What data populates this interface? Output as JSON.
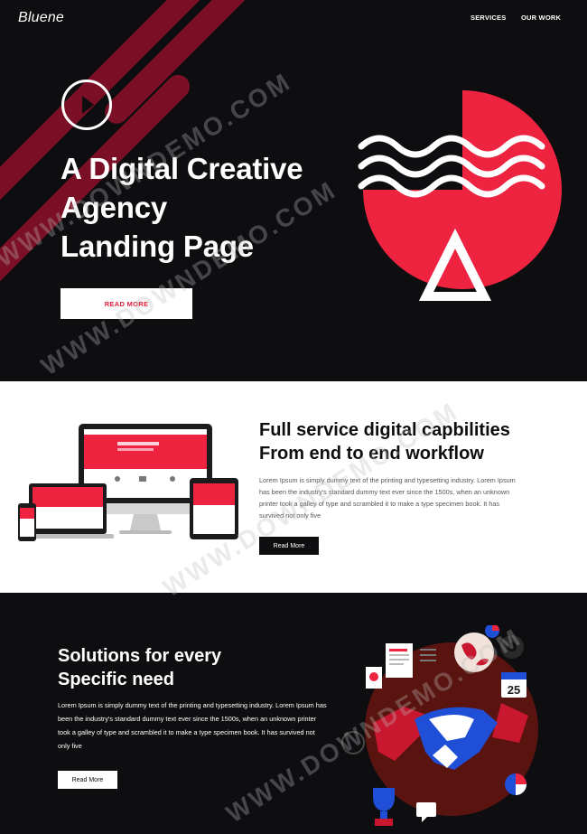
{
  "header": {
    "logo": "Bluene",
    "nav": [
      "SERVICES",
      "OUR WORK"
    ]
  },
  "hero": {
    "title_lines": [
      "A Digital Creative",
      "Agency",
      "Landing Page"
    ],
    "button": "READ MORE"
  },
  "services": {
    "title_lines": [
      "Full service digital capbilities",
      "From end to end workflow"
    ],
    "text": "Lorem Ipsum is simply dummy text of the printing and typesetting industry. Lorem Ipsum has been the industry's standard dummy text ever since the 1500s, when an unknown printer took a galley of type and scrambled it to make a type specimen book. It has survived not only five",
    "button": "Read More"
  },
  "solutions": {
    "title_lines": [
      "Solutions for every",
      "Specific need"
    ],
    "text": "Lorem Ipsum is simply dummy text of the printing and typesetting industry. Lorem Ipsum has been the industry's standard dummy text ever since the 1500s, when an unknown printer took a galley of type and scrambled it to make a type specimen book. It has survived not only five",
    "button": "Read More",
    "calendar_day": "25"
  },
  "watermark": "WWW.DOWNDEMO.COM",
  "colors": {
    "dark": "#0e0d10",
    "accent": "#ee2340",
    "stripe": "#7a0f25",
    "blue": "#1f4fd6"
  },
  "icons": [
    "play-icon",
    "waves-icon",
    "triangle-icon",
    "handshake-icon",
    "trophy-icon",
    "globe-icon",
    "gear-icon",
    "calendar-icon",
    "chat-icon"
  ]
}
